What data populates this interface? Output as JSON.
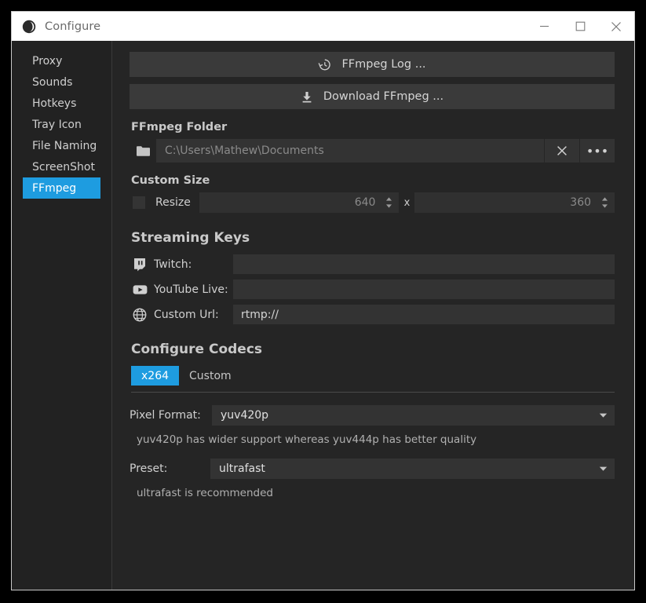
{
  "window": {
    "title": "Configure",
    "logo_icon": "app-circle-logo",
    "controls": {
      "minimize": "minimize-icon",
      "maximize": "maximize-icon",
      "close": "close-icon"
    }
  },
  "sidebar": {
    "items": [
      {
        "label": "Proxy",
        "selected": false
      },
      {
        "label": "Sounds",
        "selected": false
      },
      {
        "label": "Hotkeys",
        "selected": false
      },
      {
        "label": "Tray Icon",
        "selected": false
      },
      {
        "label": "File Naming",
        "selected": false
      },
      {
        "label": "ScreenShot",
        "selected": false
      },
      {
        "label": "FFmpeg",
        "selected": true
      }
    ],
    "selected_color": "#1e9ce0"
  },
  "main": {
    "buttons": [
      {
        "label": "FFmpeg Log ...",
        "icon": "history-clock-icon"
      },
      {
        "label": "Download FFmpeg ...",
        "icon": "download-icon"
      }
    ],
    "ffmpeg_folder": {
      "heading": "FFmpeg Folder",
      "folder_icon": "folder-icon",
      "path_placeholder": "C:\\Users\\Mathew\\Documents",
      "path_value": "",
      "clear_icon": "close-x-icon",
      "browse_label": "•••"
    },
    "custom_size": {
      "heading": "Custom Size",
      "checkbox_label": "Resize",
      "checked": false,
      "width_value": "640",
      "separator": "x",
      "height_value": "360"
    },
    "streaming_keys": {
      "heading": "Streaming Keys",
      "rows": [
        {
          "icon": "twitch-icon",
          "label": "Twitch:",
          "value": ""
        },
        {
          "icon": "youtube-icon",
          "label": "YouTube Live:",
          "value": ""
        },
        {
          "icon": "globe-icon",
          "label": "Custom Url:",
          "value": "rtmp://"
        }
      ]
    },
    "configure_codecs": {
      "heading": "Configure Codecs",
      "tabs": [
        {
          "label": "x264",
          "active": true
        },
        {
          "label": "Custom",
          "active": false
        }
      ],
      "pixel_format": {
        "label": "Pixel Format:",
        "value": "yuv420p",
        "hint": "yuv420p has wider support whereas yuv444p has better quality"
      },
      "preset": {
        "label": "Preset:",
        "value": "ultrafast",
        "hint": "ultrafast is recommended"
      }
    }
  }
}
